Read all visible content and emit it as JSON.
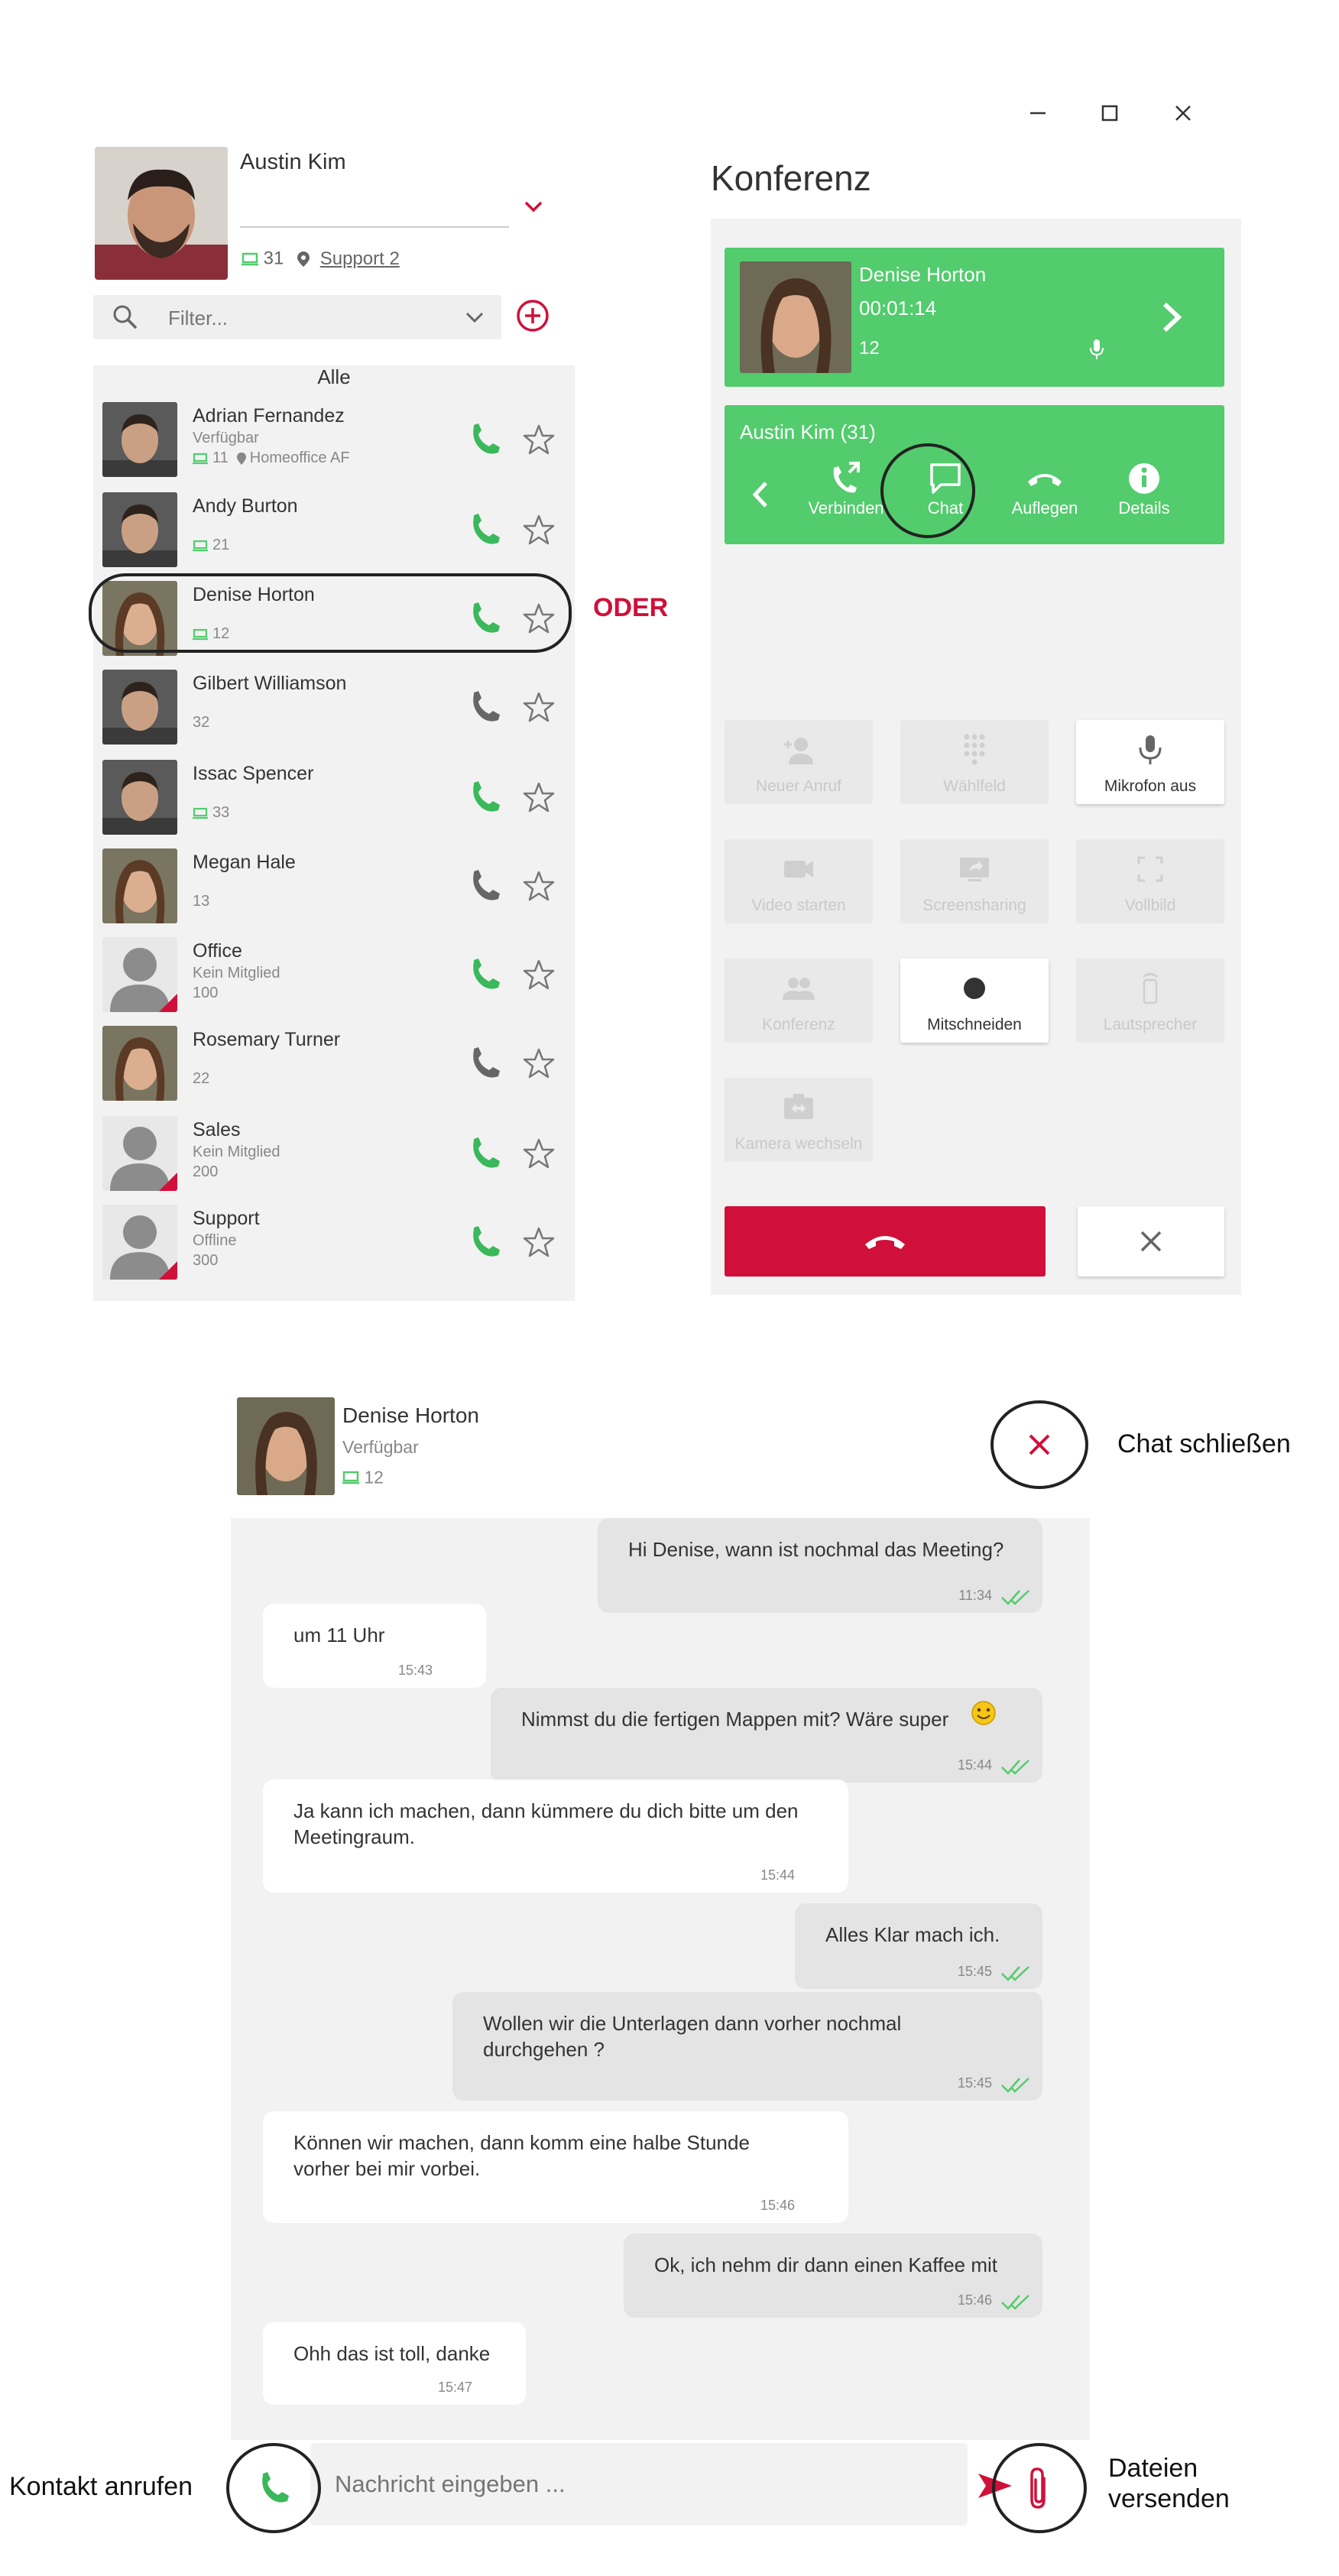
{
  "profile": {
    "name": "Austin Kim",
    "extension": "31",
    "location": "Support 2"
  },
  "filter": {
    "placeholder": "Filter..."
  },
  "contacts_header": "Alle",
  "contacts": [
    {
      "name": "Adrian Fernandez",
      "status": "Verfügbar",
      "extension": "11",
      "location": "Homeoffice AF",
      "phone_color": "#3bb85b",
      "avatar": "man"
    },
    {
      "name": "Andy Burton",
      "status": "",
      "extension": "21",
      "location": "",
      "phone_color": "#3bb85b",
      "avatar": "man"
    },
    {
      "name": "Denise Horton",
      "status": "",
      "extension": "12",
      "location": "",
      "phone_color": "#3bb85b",
      "avatar": "woman"
    },
    {
      "name": "Gilbert Williamson",
      "status": "",
      "extension": "32",
      "location": "",
      "phone_color": "#666666",
      "avatar": "man"
    },
    {
      "name": "Issac Spencer",
      "status": "",
      "extension": "33",
      "location": "",
      "phone_color": "#3bb85b",
      "avatar": "man"
    },
    {
      "name": "Megan Hale",
      "status": "",
      "extension": "13",
      "location": "",
      "phone_color": "#666666",
      "avatar": "woman"
    },
    {
      "name": "Office",
      "status": "Kein Mitglied",
      "extension": "100",
      "location": "",
      "phone_color": "#3bb85b",
      "avatar": "group"
    },
    {
      "name": "Rosemary Turner",
      "status": "",
      "extension": "22",
      "location": "",
      "phone_color": "#666666",
      "avatar": "woman"
    },
    {
      "name": "Sales",
      "status": "Kein Mitglied",
      "extension": "200",
      "location": "",
      "phone_color": "#3bb85b",
      "avatar": "group"
    },
    {
      "name": "Support",
      "status": "Offline",
      "extension": "300",
      "location": "",
      "phone_color": "#3bb85b",
      "avatar": "group"
    }
  ],
  "annotation_oder": "ODER",
  "conference": {
    "title": "Konferenz",
    "participant": {
      "name": "Denise Horton",
      "duration": "00:01:14",
      "extension": "12"
    },
    "self": {
      "label": "Austin Kim (31)"
    },
    "actions": [
      {
        "label": "Verbinden",
        "icon": "transfer-icon"
      },
      {
        "label": "Chat",
        "icon": "chat-icon"
      },
      {
        "label": "Auflegen",
        "icon": "hangup-icon"
      },
      {
        "label": "Details",
        "icon": "info-icon"
      }
    ],
    "tiles": [
      {
        "label": "Neuer Anruf",
        "icon": "add-person-icon",
        "active": false
      },
      {
        "label": "Wählfeld",
        "icon": "dialpad-icon",
        "active": false
      },
      {
        "label": "Mikrofon aus",
        "icon": "microphone-icon",
        "active": true
      },
      {
        "label": "Video starten",
        "icon": "video-icon",
        "active": false
      },
      {
        "label": "Screensharing",
        "icon": "screenshare-icon",
        "active": false
      },
      {
        "label": "Vollbild",
        "icon": "fullscreen-icon",
        "active": false
      },
      {
        "label": "Konferenz",
        "icon": "group-icon",
        "active": false
      },
      {
        "label": "Mitschneiden",
        "icon": "record-icon",
        "active": true
      },
      {
        "label": "Lautsprecher",
        "icon": "speaker-icon",
        "active": false
      },
      {
        "label": "Kamera wechseln",
        "icon": "switch-camera-icon",
        "active": false
      }
    ]
  },
  "chat": {
    "contact": {
      "name": "Denise Horton",
      "status": "Verfügbar",
      "extension": "12"
    },
    "messages": [
      {
        "dir": "out",
        "text": "Hi Denise, wann ist nochmal das Meeting?",
        "time": "11:34"
      },
      {
        "dir": "in",
        "text": "um 11 Uhr",
        "time": "15:43"
      },
      {
        "dir": "out",
        "text": "Nimmst du die fertigen Mappen mit? Wäre super",
        "time": "15:44"
      },
      {
        "dir": "in",
        "text": "Ja kann ich machen, dann kümmere du dich bitte um den\nMeetingraum.",
        "time": "15:44"
      },
      {
        "dir": "out",
        "text": "Alles Klar mach ich.",
        "time": "15:45"
      },
      {
        "dir": "out",
        "text": "Wollen wir die Unterlagen dann vorher nochmal\ndurchgehen ?",
        "time": "15:45"
      },
      {
        "dir": "in",
        "text": "Können wir machen, dann komm eine halbe Stunde\nvorher bei mir vorbei.",
        "time": "15:46"
      },
      {
        "dir": "out",
        "text": "Ok, ich nehm dir dann einen Kaffee mit",
        "time": "15:46"
      },
      {
        "dir": "in",
        "text": "Ohh das ist toll, danke",
        "time": "15:47"
      }
    ],
    "input_placeholder": "Nachricht eingeben ..."
  },
  "annotations": {
    "close_chat": "Chat schließen",
    "call_contact": "Kontakt anrufen",
    "send_files_line1": "Dateien",
    "send_files_line2": "versenden"
  },
  "colors": {
    "green": "#52cc6d",
    "red": "#d0103a",
    "panel": "#f2f2f2"
  }
}
